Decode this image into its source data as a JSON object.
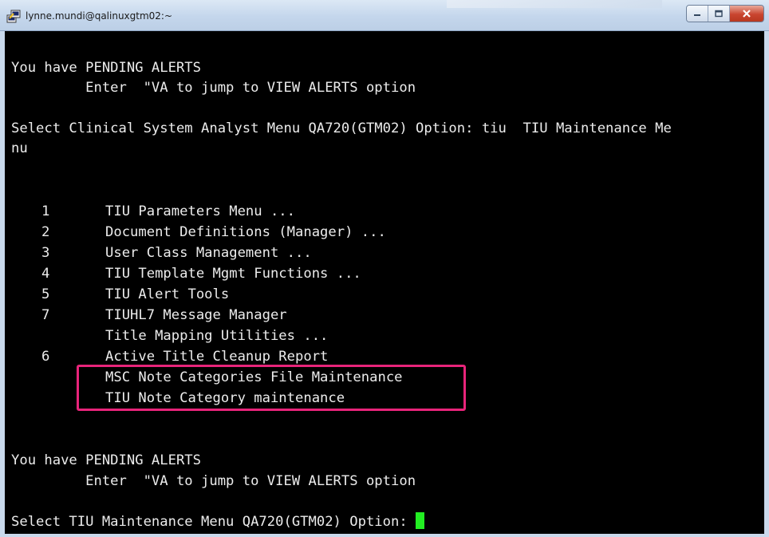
{
  "window": {
    "title": "lynne.mundi@qalinuxgtm02:~",
    "icon": "putty-terminal-icon",
    "controls": {
      "minimize_icon": "minimize-icon",
      "maximize_icon": "maximize-icon",
      "close_icon": "close-icon"
    }
  },
  "terminal": {
    "alert1": "You have PENDING ALERTS",
    "alert1_hint": "         Enter  \"VA to jump to VIEW ALERTS option",
    "prompt1": "Select Clinical System Analyst Menu QA720(GTM02) Option: tiu  TIU Maintenance Me",
    "prompt1_wrap": "nu",
    "menu_items": [
      {
        "number": "1",
        "label": "TIU Parameters Menu ..."
      },
      {
        "number": "2",
        "label": "Document Definitions (Manager) ..."
      },
      {
        "number": "3",
        "label": "User Class Management ..."
      },
      {
        "number": "4",
        "label": "TIU Template Mgmt Functions ..."
      },
      {
        "number": "5",
        "label": "TIU Alert Tools"
      },
      {
        "number": "7",
        "label": "TIUHL7 Message Manager"
      },
      {
        "number": "",
        "label": "Title Mapping Utilities ..."
      },
      {
        "number": "6",
        "label": "Active Title Cleanup Report"
      },
      {
        "number": "",
        "label": "MSC Note Categories File Maintenance"
      },
      {
        "number": "",
        "label": "TIU Note Category maintenance"
      }
    ],
    "alert2": "You have PENDING ALERTS",
    "alert2_hint": "         Enter  \"VA to jump to VIEW ALERTS option",
    "prompt2": "Select TIU Maintenance Menu QA720(GTM02) Option: "
  },
  "colors": {
    "terminal_bg": "#000000",
    "terminal_fg": "#ececec",
    "cursor": "#22ee22",
    "highlight": "#e8247a"
  }
}
